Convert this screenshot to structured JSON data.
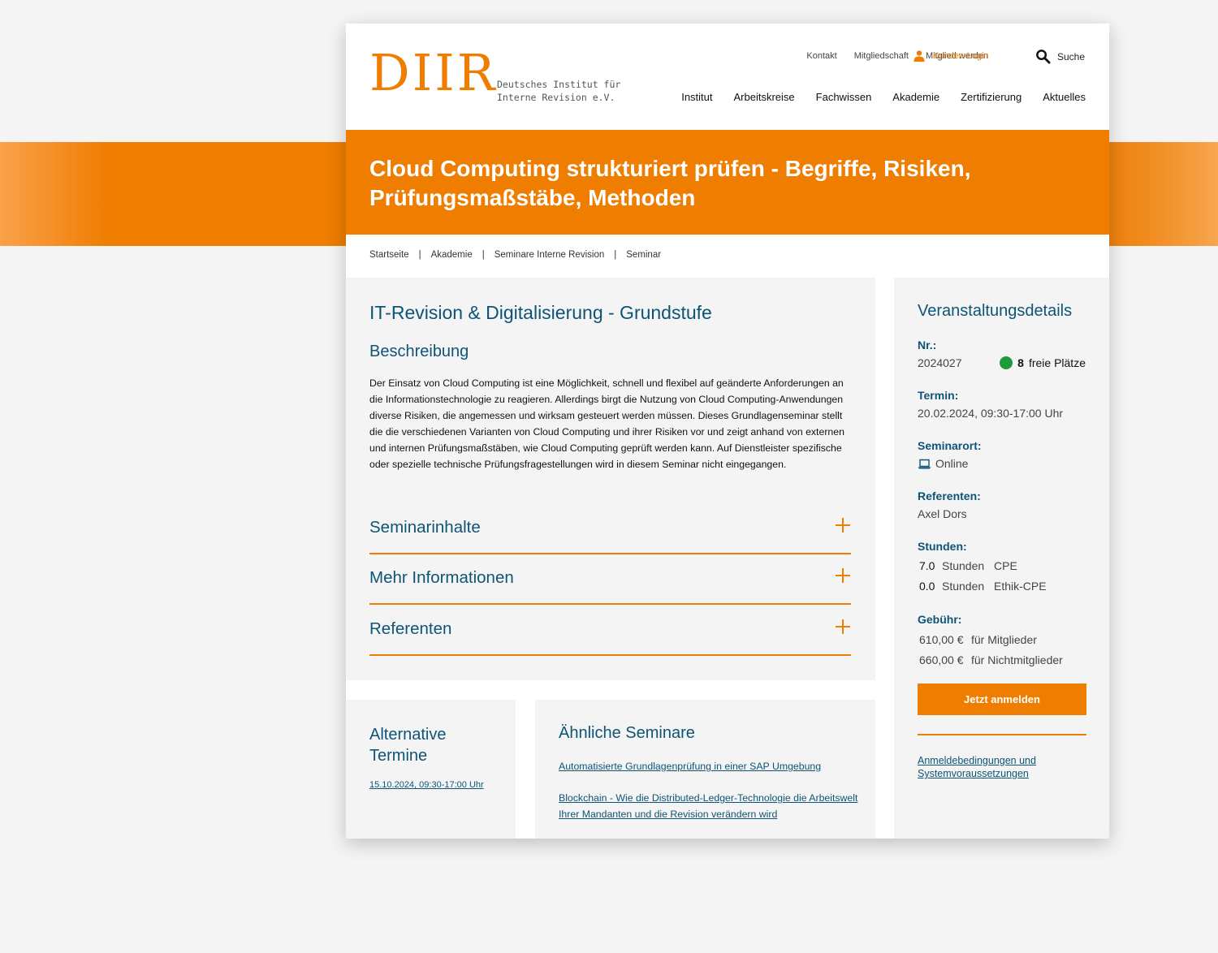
{
  "logo": {
    "mark": "DIIR",
    "line1": "Deutsches Institut für",
    "line2": "Interne Revision e.V."
  },
  "topnav": {
    "kontakt": "Kontakt",
    "mitgliedschaft": "Mitgliedschaft",
    "mitglied_werden": "Mitglied werden",
    "login": "Kunden-Login",
    "search": "Suche"
  },
  "mainnav": [
    "Institut",
    "Arbeitskreise",
    "Fachwissen",
    "Akademie",
    "Zertifizierung",
    "Aktuelles"
  ],
  "hero": {
    "title": "Cloud Computing strukturiert prüfen - Begriffe, Risiken, Prüfungsmaßstäbe, Methoden"
  },
  "breadcrumb": [
    "Startseite",
    "Akademie",
    "Seminare Interne Revision",
    "Seminar"
  ],
  "main": {
    "category": "IT-Revision & Digitalisierung - Grundstufe",
    "desc_heading": "Beschreibung",
    "description": "Der Einsatz von Cloud Computing ist eine Möglichkeit, schnell und flexibel auf geänderte Anforderungen an die Informationstechnologie zu reagieren. Allerdings birgt die Nutzung von Cloud Computing-Anwendungen diverse Risiken, die angemessen und wirksam gesteuert werden müssen. Dieses Grundlagenseminar stellt die die verschiedenen Varianten von Cloud Computing und ihrer Risiken vor und zeigt anhand von externen und internen Prüfungsmaßstäben, wie Cloud Computing geprüft werden kann. Auf Dienstleister spezifische oder spezielle technische Prüfungsfragestellungen wird in diesem Seminar nicht eingegangen.",
    "accordions": [
      "Seminarinhalte",
      "Mehr Informationen",
      "Referenten"
    ]
  },
  "details": {
    "heading": "Veranstaltungsdetails",
    "nr_label": "Nr.:",
    "nr_value": "2024027",
    "places_count": "8",
    "places_label": "freie Plätze",
    "places_color": "#1e9a3a",
    "termin_label": "Termin:",
    "termin_value": "20.02.2024, 09:30-17:00 Uhr",
    "ort_label": "Seminarort:",
    "ort_value": "Online",
    "ort_icon": "laptop-icon",
    "ref_label": "Referenten:",
    "ref_value": "Axel Dors",
    "stunden_label": "Stunden:",
    "stunden": [
      {
        "value": "7.0",
        "unit": "Stunden",
        "type": "CPE"
      },
      {
        "value": "0.0",
        "unit": "Stunden",
        "type": "Ethik-CPE"
      }
    ],
    "gebuehr_label": "Gebühr:",
    "gebuehren": [
      {
        "price": "610,00 €",
        "for": "für Mitglieder"
      },
      {
        "price": "660,00 €",
        "for": "für Nichtmitglieder"
      }
    ],
    "cta": "Jetzt anmelden",
    "terms_link": "Anmeldebedingungen und Systemvoraussetzungen"
  },
  "alternative": {
    "heading": "Alternative Termine",
    "date_link": "15.10.2024, 09:30-17:00 Uhr"
  },
  "similar": {
    "heading": "Ähnliche Seminare",
    "links": [
      "Automatisierte Grundlagenprüfung in einer SAP Umgebung",
      "Blockchain - Wie die Distributed-Ledger-Technologie die Arbeitswelt Ihrer Mandanten und die Revision verändern wird"
    ]
  },
  "colors": {
    "accent": "#ee7d00",
    "heading": "#0e5477",
    "panel": "#f4f4f4"
  }
}
